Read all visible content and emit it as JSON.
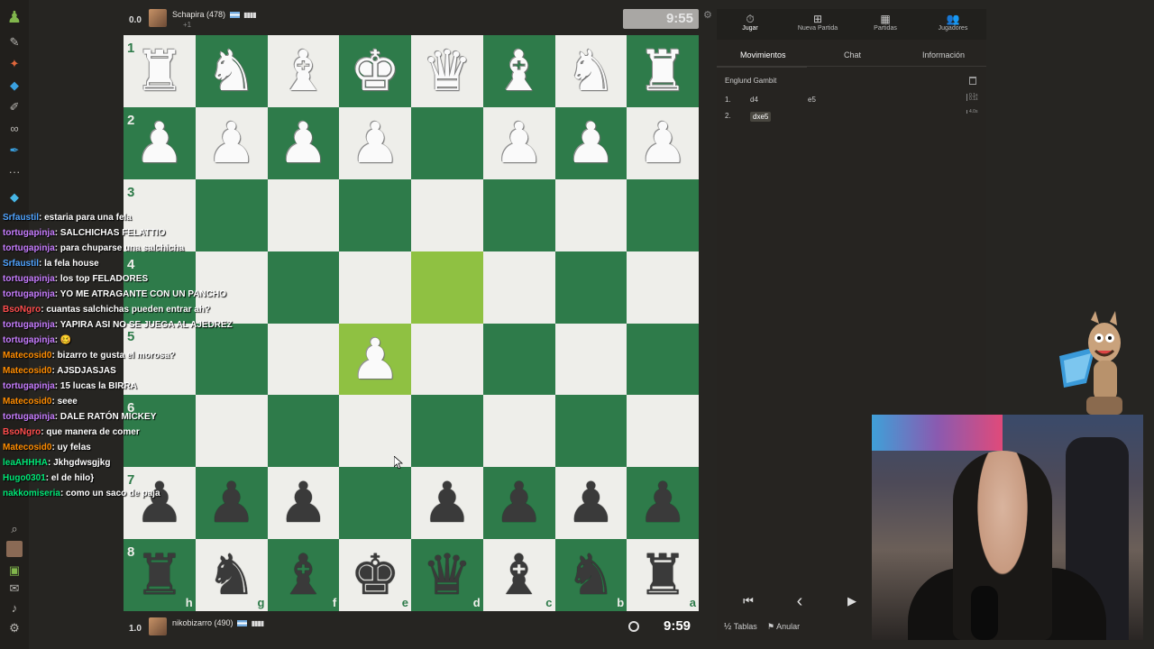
{
  "rail": {
    "icons": [
      "pawn-logo-icon",
      "puzzle-icon",
      "lesson-icon",
      "learn-icon",
      "watch-icon",
      "binoculars-icon",
      "news-icon",
      "more-icon",
      "diamond-icon"
    ],
    "bottom_icons": [
      "search-icon",
      "avatar-icon",
      "gift-icon",
      "messages-icon",
      "bell-icon",
      "settings-icon"
    ]
  },
  "top_player": {
    "score": "0.0",
    "name": "Schapira",
    "rating": "(478)",
    "sub": "+1",
    "clock": "9:55"
  },
  "bottom_player": {
    "score": "1.0",
    "name": "nikobizarro",
    "rating": "(490)",
    "clock": "9:59"
  },
  "board": {
    "ranks": [
      "1",
      "2",
      "3",
      "4",
      "5",
      "6",
      "7",
      "8"
    ],
    "files": [
      "h",
      "g",
      "f",
      "e",
      "d",
      "c",
      "b",
      "a"
    ],
    "pieces": [
      [
        "♖",
        "♘",
        "♗",
        "♔",
        "♕",
        "♗",
        "♘",
        "♖"
      ],
      [
        "♙",
        "♙",
        "♙",
        "♙",
        "",
        "♙",
        "♙",
        "♙"
      ],
      [
        "",
        "",
        "",
        "",
        "",
        "",
        "",
        ""
      ],
      [
        "",
        "",
        "",
        "",
        "",
        "",
        "",
        ""
      ],
      [
        "",
        "",
        "",
        "♙",
        "",
        "",
        "",
        ""
      ],
      [
        "",
        "",
        "",
        "",
        "",
        "",
        "",
        ""
      ],
      [
        "♟",
        "♟",
        "♟",
        "",
        "♟",
        "♟",
        "♟",
        "♟"
      ],
      [
        "♜",
        "♞",
        "♝",
        "♚",
        "♛",
        "♝",
        "♞",
        "♜"
      ]
    ],
    "highlight": [
      [
        3,
        4
      ],
      [
        4,
        3
      ]
    ],
    "colors": {
      "light": "#eeeeea",
      "dark": "#2e7b4a",
      "highlight": "#8fc142"
    }
  },
  "chat": [
    {
      "user": "Srfaustil",
      "color": "#4fa3ff",
      "msg": "estaria para una fela"
    },
    {
      "user": "tortugapinja",
      "color": "#c77dff",
      "msg": "SALCHICHAS FELATTIO"
    },
    {
      "user": "tortugapinja",
      "color": "#c77dff",
      "msg": "para chuparse una salchicha"
    },
    {
      "user": "Srfaustil",
      "color": "#4fa3ff",
      "msg": "la fela house"
    },
    {
      "user": "tortugapinja",
      "color": "#c77dff",
      "msg": "los top FELADORES"
    },
    {
      "user": "tortugapinja",
      "color": "#c77dff",
      "msg": "YO ME ATRAGANTE CON UN PANCHO"
    },
    {
      "user": "BsoNgro",
      "color": "#ff4d4d",
      "msg": "cuantas salchichas pueden entrar ah?"
    },
    {
      "user": "tortugapinja",
      "color": "#c77dff",
      "msg": "YAPIRA ASI NO SE JUEGA AL AJEDREZ"
    },
    {
      "user": "tortugapinja",
      "color": "#c77dff",
      "msg": "🥴"
    },
    {
      "user": "Matecosid0",
      "color": "#ff8c00",
      "msg": "bizarro te gusta el morosa?"
    },
    {
      "user": "Matecosid0",
      "color": "#ff8c00",
      "msg": "AJSDJASJAS"
    },
    {
      "user": "tortugapinja",
      "color": "#c77dff",
      "msg": "15 lucas la BIRRA"
    },
    {
      "user": "Matecosid0",
      "color": "#ff8c00",
      "msg": "seee"
    },
    {
      "user": "tortugapinja",
      "color": "#c77dff",
      "msg": "DALE RATÓN MICKEY"
    },
    {
      "user": "BsoNgro",
      "color": "#ff4d4d",
      "msg": "que manera de comer"
    },
    {
      "user": "Matecosid0",
      "color": "#ff8c00",
      "msg": "uy felas"
    },
    {
      "user": "leaAHHHA",
      "color": "#00e676",
      "msg": "Jkhgdwsgjkg"
    },
    {
      "user": "Hugo0301",
      "color": "#00e676",
      "msg": "el de hilo}"
    },
    {
      "user": "nakkomiseria",
      "color": "#00e676",
      "msg": "como un saco de paja"
    }
  ],
  "nav": [
    {
      "label": "Jugar",
      "icon": "clock-icon",
      "glyph": "⏱"
    },
    {
      "label": "Nueva Partida",
      "icon": "plus-square-icon",
      "glyph": "⊞"
    },
    {
      "label": "Partidas",
      "icon": "board-icon",
      "glyph": "▦"
    },
    {
      "label": "Jugadores",
      "icon": "players-icon",
      "glyph": "👥"
    }
  ],
  "tabs": [
    "Movimientos",
    "Chat",
    "Información"
  ],
  "opening": "Englund Gambit",
  "moves": [
    {
      "num": "1.",
      "white": "d4",
      "black": "e5",
      "t1": "0.1s",
      "t2": "0.1s"
    },
    {
      "num": "2.",
      "white": "dxe5",
      "black": "",
      "t1": "4.0s",
      "t2": ""
    }
  ],
  "controls": {
    "first": "⏮",
    "prev": "‹",
    "next": "▶",
    "draw_label": "Tablas",
    "abort_label": "Anular"
  }
}
